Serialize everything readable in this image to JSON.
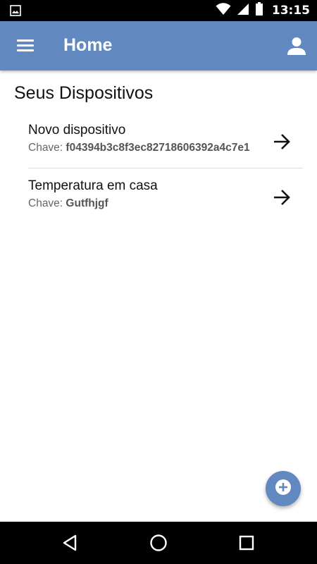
{
  "status_bar": {
    "time": "13:15",
    "icons": [
      "image-notification-icon",
      "wifi-icon",
      "signal-icon",
      "battery-icon"
    ]
  },
  "app_bar": {
    "title": "Home",
    "menu_icon": "menu-icon",
    "account_icon": "account-icon",
    "color": "#6189bf"
  },
  "main": {
    "section_title": "Seus Dispositivos",
    "devices": [
      {
        "name": "Novo dispositivo",
        "key_label": "Chave: ",
        "key_value": "f04394b3c8f3ec82718606392a4c7e1"
      },
      {
        "name": "Temperatura em casa",
        "key_label": "Chave: ",
        "key_value": "Gutfhjgf"
      }
    ]
  },
  "fab": {
    "icon": "add-circle-icon"
  },
  "nav_bar": {
    "icons": [
      "back-icon",
      "home-icon",
      "recents-icon"
    ]
  }
}
